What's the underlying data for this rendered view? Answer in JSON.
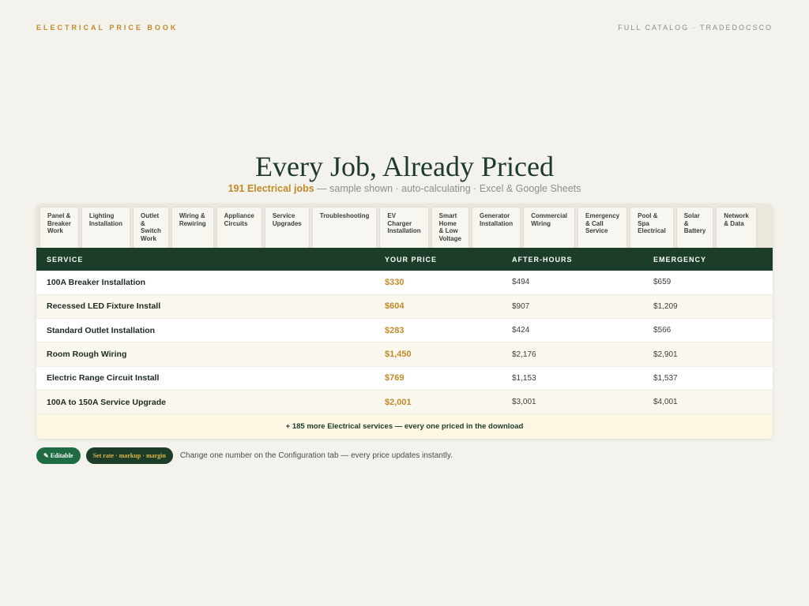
{
  "header": {
    "left_label": "ELECTRICAL PRICE BOOK",
    "right_label": "FULL CATALOG · TRADEDOCSCO"
  },
  "hero": {
    "title": "Every Job, Already Priced",
    "subtitle_accent": "191 Electrical jobs",
    "subtitle_rest": " — sample shown · auto-calculating · Excel & Google Sheets"
  },
  "tabs": [
    "Panel &\nBreaker\nWork",
    "Lighting\nInstallation",
    "Outlet\n&\nSwitch\nWork",
    "Wiring &\nRewiring",
    "Appliance\nCircuits",
    "Service\nUpgrades",
    "Troubleshooting",
    "EV\nCharger\nInstallation",
    "Smart\nHome\n& Low\nVoltage",
    "Generator\nInstallation",
    "Commercial\nWiring",
    "Emergency\n& Call\nService",
    "Pool &\nSpa\nElectrical",
    "Solar\n&\nBattery",
    "Network\n& Data"
  ],
  "table": {
    "headers": [
      "SERVICE",
      "YOUR PRICE",
      "AFTER-HOURS",
      "EMERGENCY"
    ],
    "rows": [
      [
        "100A Breaker Installation",
        "$330",
        "$494",
        "$659"
      ],
      [
        "Recessed LED Fixture Install",
        "$604",
        "$907",
        "$1,209"
      ],
      [
        "Standard Outlet Installation",
        "$283",
        "$424",
        "$566"
      ],
      [
        "Room Rough Wiring",
        "$1,450",
        "$2,176",
        "$2,901"
      ],
      [
        "Electric Range Circuit Install",
        "$769",
        "$1,153",
        "$1,537"
      ],
      [
        "100A to 150A Service Upgrade",
        "$2,001",
        "$3,001",
        "$4,001"
      ]
    ],
    "more_text": "+ 185 more Electrical services — every one priced in the download"
  },
  "footer": {
    "editable_label": "✎ Editable",
    "config_label": "Set rate · markup · margin",
    "note": "Change one number on the Configuration tab — every price updates instantly."
  },
  "colors": {
    "accent": "#c08a2a",
    "header_green": "#1b3d2a",
    "editable_green": "#1f6b43",
    "background": "#f4f2ec"
  }
}
